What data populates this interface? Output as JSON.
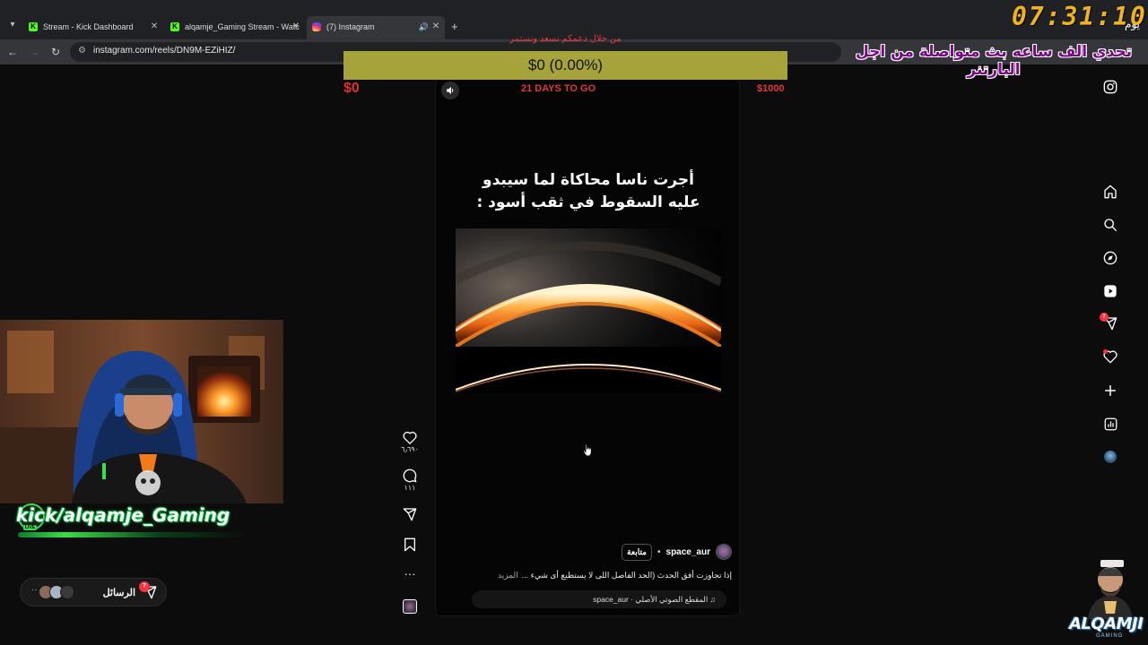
{
  "browser": {
    "tabs": [
      {
        "title": "Stream - Kick Dashboard",
        "favicon": "kick-icon",
        "active": false
      },
      {
        "title": "alqamje_Gaming Stream - Watc",
        "favicon": "kick-icon",
        "active": false
      },
      {
        "title": "(7) Instagram",
        "favicon": "instagram-icon",
        "active": true
      }
    ],
    "url": "instagram.com/reels/DN9M-EZiHIZ/"
  },
  "donation_goal": {
    "caption": "من خلال دعمكم نسعد ونستمر",
    "progress_text": "$0 (0.00%)",
    "progress_fraction": 0,
    "start_amount": "$0",
    "days_left": "21 DAYS TO GO",
    "target_amount": "$1000",
    "bar_color": "#a7a33b",
    "text_color": "#e03939"
  },
  "stream_overlay": {
    "timer": "07:31:10",
    "timer_suffix": "يوم",
    "challenge_text": "تحدي الف ساعه بث متواصلة من اجل البارتنر",
    "handle": "kick/alqamje_Gaming",
    "live_label": "LIVE",
    "logo": "ALQAMJI",
    "logo_sub": "GAMING"
  },
  "reel": {
    "headline_line1": "أجرت ناسا محاكاة لما سيبدو",
    "headline_line2": "عليه السقوط في ثقب أسود :",
    "username": "space_aur",
    "follow_label": "متابعة",
    "caption": "إذا تجاوزت أفق الحدث (الحد الفاصل اللى لا يستطيع أى شيء ...",
    "caption_more": "المزيد",
    "audio": "المقطع الصوتي الأصلي · space_aur",
    "actions": {
      "likes": "٦٫٦٩٠",
      "comments": "١١١"
    }
  },
  "messages": {
    "label": "الرسائل",
    "badge": "7"
  },
  "sidebar": {
    "icons": [
      "instagram-logo-icon",
      "home-icon",
      "search-icon",
      "explore-icon",
      "reels-icon",
      "messages-icon",
      "notifications-icon",
      "create-icon",
      "dashboard-icon",
      "profile-icon"
    ],
    "messages_badge": "7"
  },
  "colors": {
    "accent_green": "#3ade4a",
    "timer_orange": "#f2b21b",
    "banner_purple": "#7a0a86",
    "badge_red": "#ff3040"
  }
}
